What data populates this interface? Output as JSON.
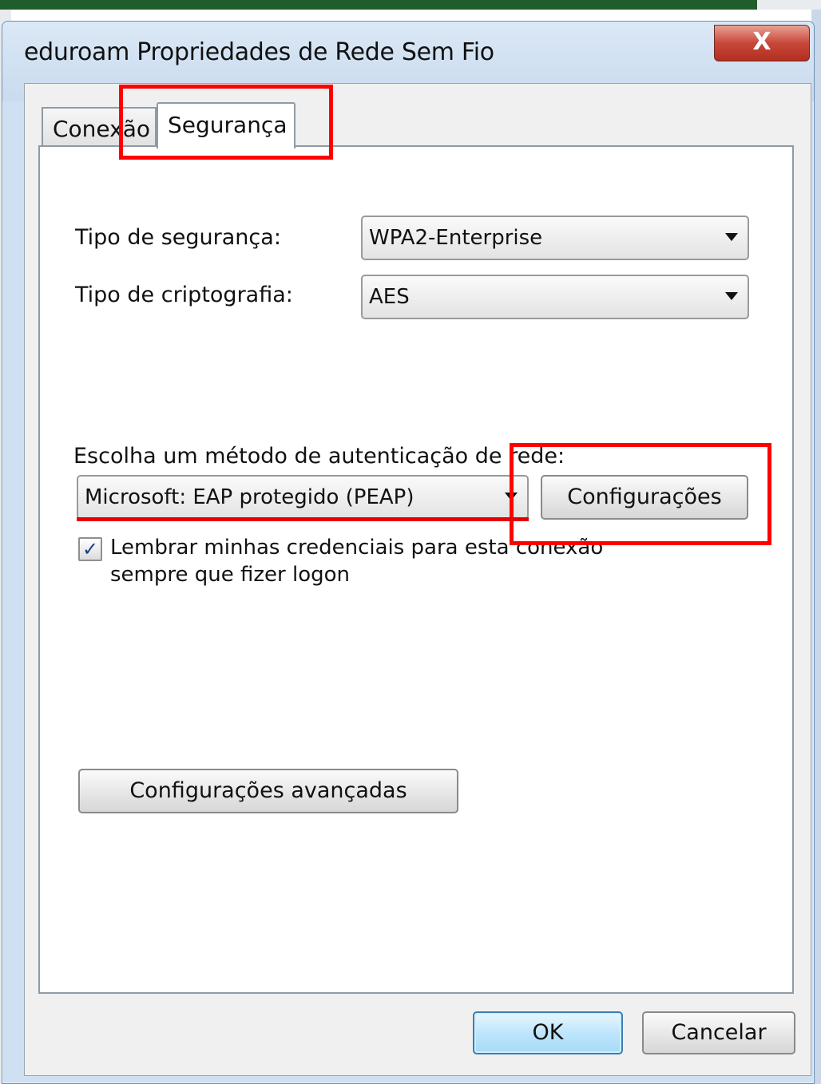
{
  "window": {
    "title": "eduroam Propriedades de Rede Sem Fio",
    "close_icon": "close-icon",
    "close_label": "X"
  },
  "tabs": [
    {
      "label": "Conexão",
      "active": false
    },
    {
      "label": "Segurança",
      "active": true
    }
  ],
  "security": {
    "type_label": "Tipo de segurança:",
    "type_value": "WPA2-Enterprise",
    "encryption_label": "Tipo de criptografia:",
    "encryption_value": "AES"
  },
  "auth": {
    "method_label": "Escolha um método de autenticação de rede:",
    "method_value": "Microsoft: EAP protegido (PEAP)",
    "settings_button": "Configurações",
    "remember_checked": true,
    "remember_line1": "Lembrar minhas credenciais para esta conexão",
    "remember_line2": "sempre que fizer logon"
  },
  "advanced_button": "Configurações avançadas",
  "footer": {
    "ok": "OK",
    "cancel": "Cancelar"
  },
  "annotation_color": "#ff0000"
}
